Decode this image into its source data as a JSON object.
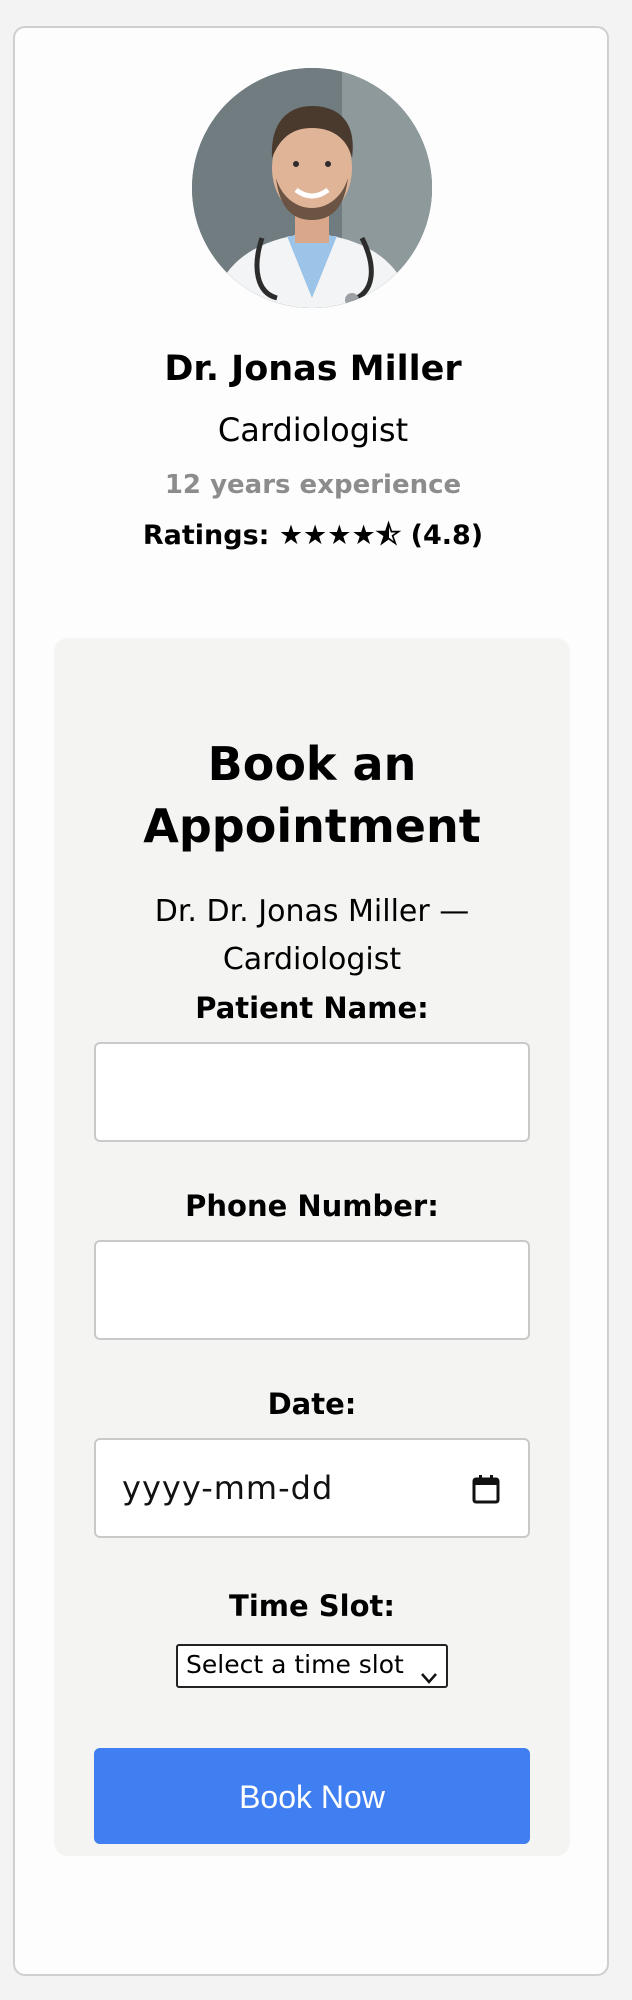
{
  "doctor": {
    "name": "Dr. Jonas Miller",
    "specialty": "Cardiologist",
    "experience": "12 years experience",
    "ratings_label": "Ratings:",
    "stars": "★★★★⯪",
    "rating_value": "(4.8)",
    "rating": 4.8
  },
  "booking": {
    "title_line1": "Book an",
    "title_line2": "Appointment",
    "subtitle_line1": "Dr. Dr. Jonas Miller —",
    "subtitle_line2": "Cardiologist",
    "patient_name_label": "Patient Name:",
    "patient_name_value": "",
    "phone_label": "Phone Number:",
    "phone_value": "",
    "date_label": "Date:",
    "date_placeholder": "yyyy-mm-dd",
    "time_slot_label": "Time Slot:",
    "time_slot_selected": "Select a time slot",
    "button_label": "Book Now"
  },
  "icons": {
    "calendar": "calendar-icon",
    "chevron": "chevron-down-icon"
  },
  "colors": {
    "button": "#3f7ff1",
    "muted_text": "#8c8c8c",
    "panel": "#f4f4f3"
  }
}
